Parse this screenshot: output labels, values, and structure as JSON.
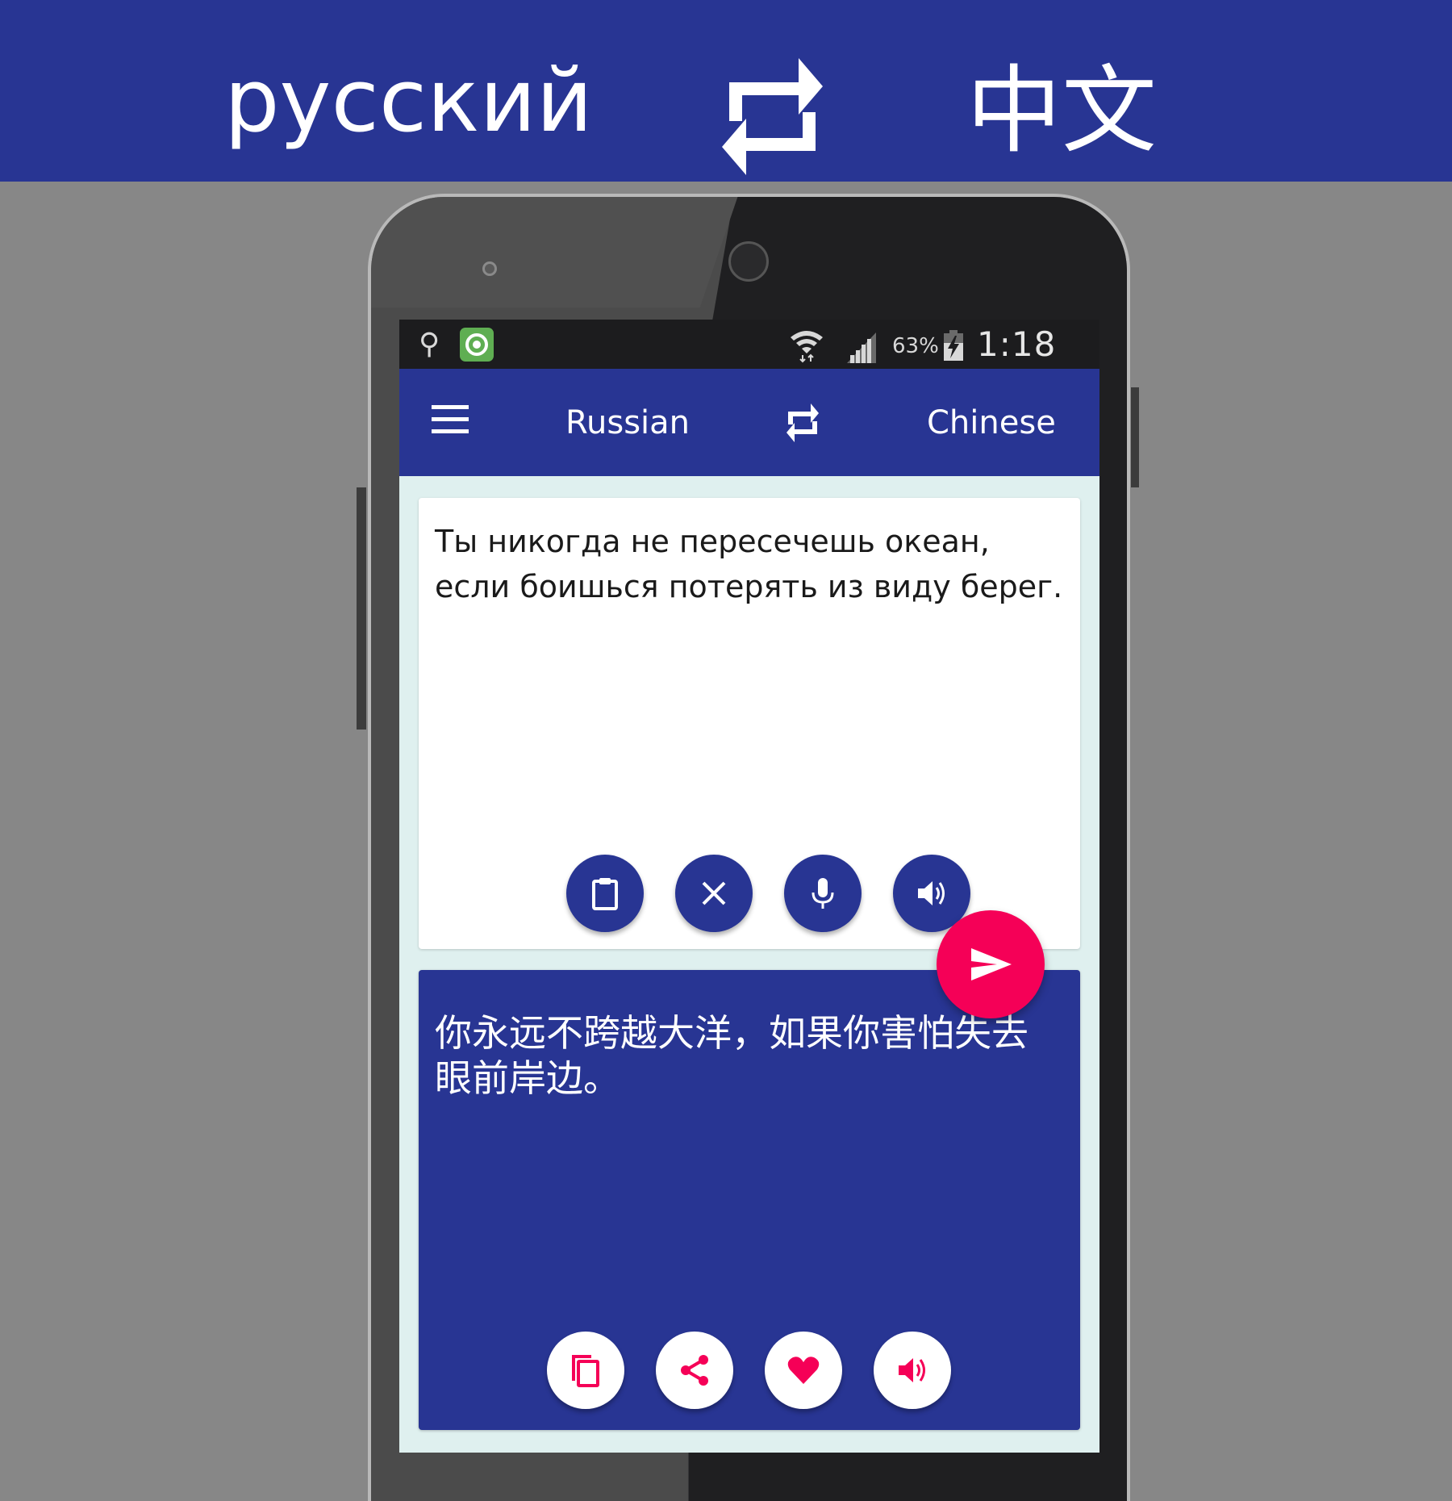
{
  "banner": {
    "source_language": "русский",
    "target_language": "中文",
    "swap_icon": "swap-arrows-icon"
  },
  "statusbar": {
    "left_icons": [
      "usb-icon",
      "app-notification-icon"
    ],
    "right_icons": [
      "wifi-icon",
      "signal-icon",
      "battery-charging-icon"
    ],
    "battery_percent": "63%",
    "time": "1:18 PM"
  },
  "appbar": {
    "menu_icon": "hamburger-menu-icon",
    "source_language": "Russian",
    "swap_icon": "swap-arrows-icon",
    "target_language": "Chinese"
  },
  "input": {
    "text": "Ты никогда не пересечешь океан, если боишься потерять из виду берег.",
    "actions": [
      {
        "name": "paste",
        "icon": "clipboard-icon"
      },
      {
        "name": "clear",
        "icon": "close-icon"
      },
      {
        "name": "voice-input",
        "icon": "microphone-icon"
      },
      {
        "name": "speak",
        "icon": "speaker-icon"
      }
    ]
  },
  "translate_button": {
    "icon": "send-icon"
  },
  "output": {
    "text": "你永远不跨越大洋，如果你害怕失去眼前岸边。",
    "actions": [
      {
        "name": "copy",
        "icon": "copy-icon"
      },
      {
        "name": "share",
        "icon": "share-icon"
      },
      {
        "name": "favorite",
        "icon": "heart-icon"
      },
      {
        "name": "speak",
        "icon": "speaker-icon"
      }
    ]
  },
  "colors": {
    "primary": "#283593",
    "accent": "#f50057",
    "content_background": "#dff0ef",
    "page_background": "#878787"
  }
}
